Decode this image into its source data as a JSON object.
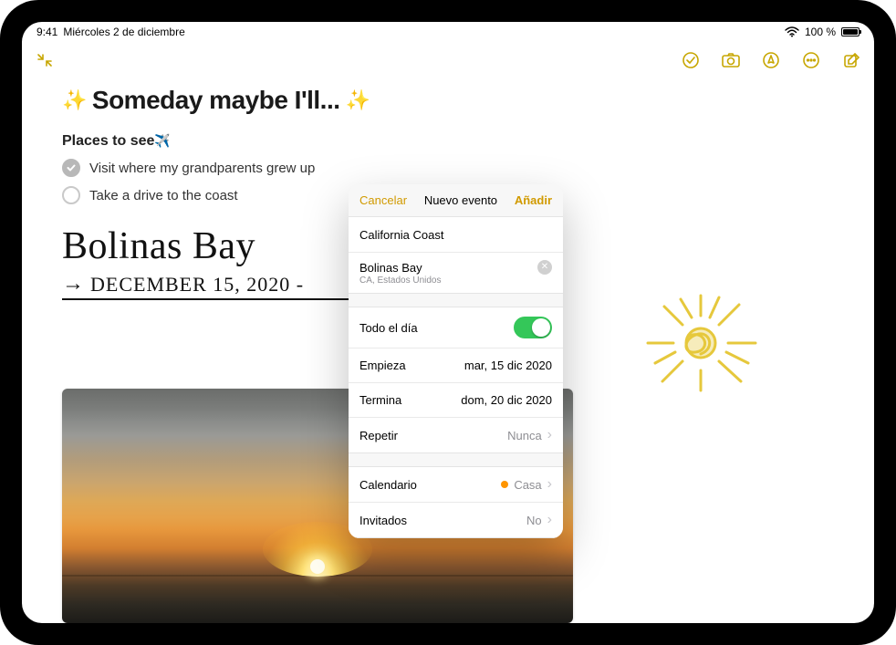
{
  "status": {
    "time": "9:41",
    "date": "Miércoles 2 de diciembre",
    "battery_text": "100 %"
  },
  "note": {
    "title": "Someday maybe I'll...",
    "section_heading": "Places to see",
    "plane_emoji": "✈️",
    "items": [
      {
        "text": "Visit where my grandparents grew up",
        "checked": true
      },
      {
        "text": "Take a drive to the coast",
        "checked": false
      }
    ],
    "handwriting_line1": "Bolinas Bay",
    "handwriting_line2": "DECEMBER 15, 2020 -"
  },
  "popover": {
    "cancel": "Cancelar",
    "title": "Nuevo evento",
    "add": "Añadir",
    "event_title": "California Coast",
    "location_name": "Bolinas Bay",
    "location_detail": "CA, Estados Unidos",
    "allday_label": "Todo el día",
    "allday_on": true,
    "starts_label": "Empieza",
    "starts_value": "mar, 15 dic 2020",
    "ends_label": "Termina",
    "ends_value": "dom, 20 dic 2020",
    "repeat_label": "Repetir",
    "repeat_value": "Nunca",
    "calendar_label": "Calendario",
    "calendar_value": "Casa",
    "calendar_color": "#ff9500",
    "invitees_label": "Invitados",
    "invitees_value": "No"
  }
}
